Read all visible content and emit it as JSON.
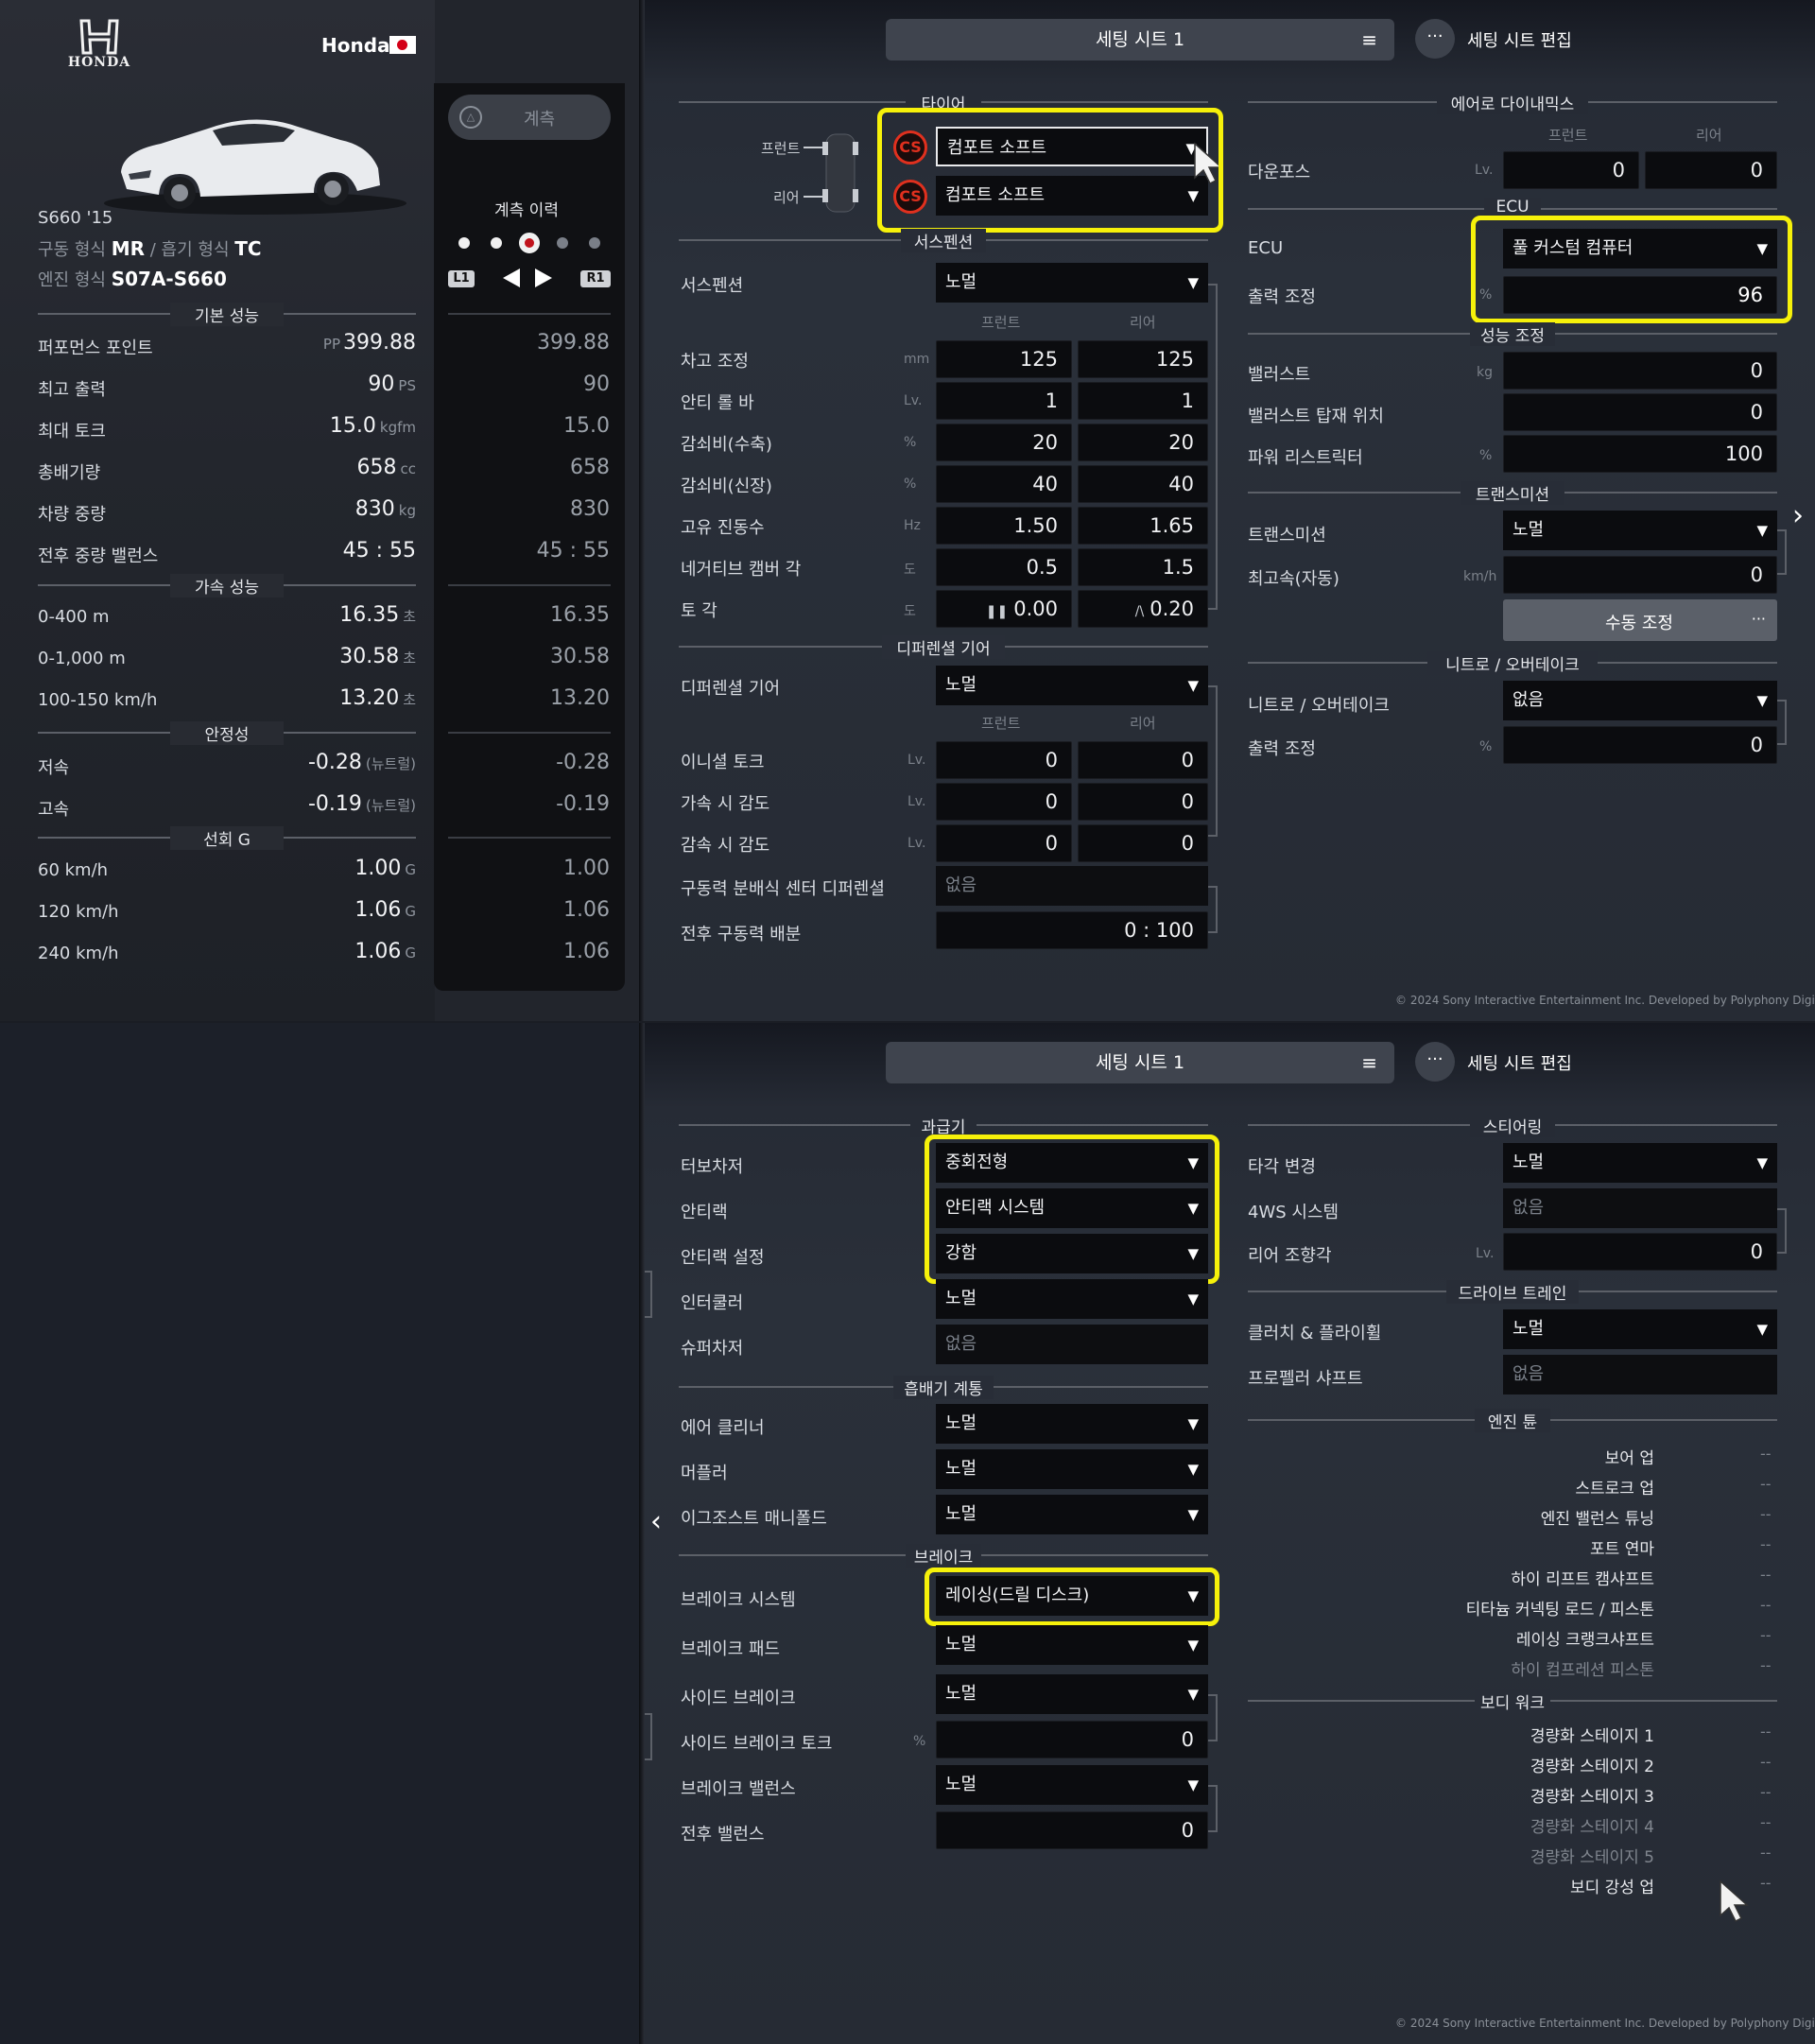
{
  "top_left": {
    "brand_logo_text": "HONDA",
    "maker": "Honda",
    "car_model": "S660 '15",
    "drivetrain_label": "구동 형식",
    "drivetrain": "MR",
    "aspiration_label": "흡기 형식",
    "aspiration": "TC",
    "engine_label": "엔진 형식",
    "engine": "S07A-S660"
  },
  "measure": {
    "button_label": "계측",
    "history_label": "계측 이력",
    "l1": "L1",
    "r1": "R1"
  },
  "basic": {
    "title": "기본 성능",
    "rows": [
      {
        "label": "퍼포먼스 포인트",
        "prefix": "PP",
        "value": "399.88",
        "unit": "",
        "cmp": "399.88"
      },
      {
        "label": "최고 출력",
        "prefix": "",
        "value": "90",
        "unit": "PS",
        "cmp": "90"
      },
      {
        "label": "최대 토크",
        "prefix": "",
        "value": "15.0",
        "unit": "kgfm",
        "cmp": "15.0"
      },
      {
        "label": "총배기량",
        "prefix": "",
        "value": "658",
        "unit": "cc",
        "cmp": "658"
      },
      {
        "label": "차량 중량",
        "prefix": "",
        "value": "830",
        "unit": "kg",
        "cmp": "830"
      },
      {
        "label": "전후 중량 밸런스",
        "prefix": "",
        "value": "45 : 55",
        "unit": "",
        "cmp": "45 : 55"
      }
    ]
  },
  "accel": {
    "title": "가속 성능",
    "rows": [
      {
        "label": "0-400 m",
        "value": "16.35",
        "unit": "초",
        "cmp": "16.35"
      },
      {
        "label": "0-1,000 m",
        "value": "30.58",
        "unit": "초",
        "cmp": "30.58"
      },
      {
        "label": "100-150 km/h",
        "value": "13.20",
        "unit": "초",
        "cmp": "13.20"
      }
    ]
  },
  "stability": {
    "title": "안정성",
    "rows": [
      {
        "label": "저속",
        "value": "-0.28",
        "unit": "(뉴트럴)",
        "cmp": "-0.28"
      },
      {
        "label": "고속",
        "value": "-0.19",
        "unit": "(뉴트럴)",
        "cmp": "-0.19"
      }
    ]
  },
  "turning": {
    "title": "선회 G",
    "rows": [
      {
        "label": "60 km/h",
        "value": "1.00",
        "unit": "G",
        "cmp": "1.00"
      },
      {
        "label": "120 km/h",
        "value": "1.06",
        "unit": "G",
        "cmp": "1.06"
      },
      {
        "label": "240 km/h",
        "value": "1.06",
        "unit": "G",
        "cmp": "1.06"
      }
    ]
  },
  "header": {
    "sheet": "세팅 시트 1",
    "more": "···",
    "edit": "세팅 시트 편집",
    "copyright": "© 2024 Sony Interactive Entertainment Inc. Developed by Polyphony Digital Inc."
  },
  "tire": {
    "title": "타이어",
    "front_label": "프런트",
    "rear_label": "리어",
    "badge": "CS",
    "front": "컴포트 소프트",
    "rear": "컴포트 소프트"
  },
  "suspension": {
    "title": "서스펜션",
    "label": "서스펜션",
    "value": "노멀",
    "col_front": "프런트",
    "col_rear": "리어",
    "rows": [
      {
        "label": "차고 조정",
        "unit": "mm",
        "front": "125",
        "rear": "125"
      },
      {
        "label": "안티 롤 바",
        "unit": "Lv.",
        "front": "1",
        "rear": "1"
      },
      {
        "label": "감쇠비(수축)",
        "unit": "%",
        "front": "20",
        "rear": "20"
      },
      {
        "label": "감쇠비(신장)",
        "unit": "%",
        "front": "40",
        "rear": "40"
      },
      {
        "label": "고유 진동수",
        "unit": "Hz",
        "front": "1.50",
        "rear": "1.65"
      },
      {
        "label": "네거티브 캠버 각",
        "unit": "도",
        "front": "0.5",
        "rear": "1.5"
      },
      {
        "label": "토 각",
        "unit": "도",
        "front": "0.00",
        "rear": "0.20"
      }
    ],
    "toe_front_icon": "❚❚",
    "toe_rear_icon": "/\\"
  },
  "diff": {
    "title": "디퍼렌셜 기어",
    "label": "디퍼렌셜 기어",
    "value": "노멀",
    "col_front": "프런트",
    "col_rear": "리어",
    "rows": [
      {
        "label": "이니셜 토크",
        "unit": "Lv.",
        "front": "0",
        "rear": "0"
      },
      {
        "label": "가속 시 감도",
        "unit": "Lv.",
        "front": "0",
        "rear": "0"
      },
      {
        "label": "감속 시 감도",
        "unit": "Lv.",
        "front": "0",
        "rear": "0"
      }
    ],
    "center_label": "구동력 분배식 센터 디퍼렌셜",
    "center_value": "없음",
    "split_label": "전후 구동력 배분",
    "split_value": "0 : 100"
  },
  "aero": {
    "title": "에어로 다이내믹스",
    "col_front": "프런트",
    "col_rear": "리어",
    "label": "다운포스",
    "unit": "Lv.",
    "front": "0",
    "rear": "0"
  },
  "ecu": {
    "title": "ECU",
    "label": "ECU",
    "value": "풀 커스텀 컴퓨터",
    "output_label": "출력 조정",
    "output_unit": "%",
    "output": "96"
  },
  "perf": {
    "title": "성능 조정",
    "ballast_label": "밸러스트",
    "ballast_unit": "kg",
    "ballast": "0",
    "ballast_pos_label": "밸러스트 탑재 위치",
    "ballast_pos": "0",
    "restrictor_label": "파워 리스트릭터",
    "restrictor_unit": "%",
    "restrictor": "100"
  },
  "trans": {
    "title": "트랜스미션",
    "label": "트랜스미션",
    "value": "노멀",
    "top_label": "최고속(자동)",
    "top_unit": "km/h",
    "top": "0",
    "manual": "수동 조정",
    "manual_more": "···"
  },
  "nitro": {
    "title": "니트로 / 오버테이크",
    "label": "니트로 / 오버테이크",
    "value": "없음",
    "output_label": "출력 조정",
    "output_unit": "%",
    "output": "0"
  },
  "forced": {
    "title": "과급기",
    "turbo_label": "터보차저",
    "turbo": "중회전형",
    "antilag_label": "안티랙",
    "antilag": "안티랙 시스템",
    "antilag_set_label": "안티랙 설정",
    "antilag_set": "강함",
    "intercooler_label": "인터쿨러",
    "intercooler": "노멀",
    "super_label": "슈퍼차저",
    "super": "없음"
  },
  "intake": {
    "title": "흡배기 계통",
    "air_label": "에어 클리너",
    "air": "노멀",
    "muffler_label": "머플러",
    "muffler": "노멀",
    "exhaust_label": "이그조스트 매니폴드",
    "exhaust": "노멀"
  },
  "brake": {
    "title": "브레이크",
    "system_label": "브레이크 시스템",
    "system": "레이싱(드릴 디스크)",
    "pad_label": "브레이크 패드",
    "pad": "노멀",
    "side_label": "사이드 브레이크",
    "side": "노멀",
    "side_torque_label": "사이드 브레이크 토크",
    "side_torque_unit": "%",
    "side_torque": "0",
    "balance_label": "브레이크 밸런스",
    "balance": "노멀",
    "fr_label": "전후 밸런스",
    "fr": "0"
  },
  "steering": {
    "title": "스티어링",
    "angle_label": "타각 변경",
    "angle": "노멀",
    "fourws_label": "4WS 시스템",
    "fourws": "없음",
    "rear_label": "리어 조향각",
    "rear_unit": "Lv.",
    "rear": "0"
  },
  "drivetrain": {
    "title": "드라이브 트레인",
    "clutch_label": "클러치 & 플라이휠",
    "clutch": "노멀",
    "prop_label": "프로펠러 샤프트",
    "prop": "없음"
  },
  "engine_tune": {
    "title": "엔진 튠",
    "items": [
      {
        "label": "보어 업",
        "value": "--"
      },
      {
        "label": "스트로크 업",
        "value": "--"
      },
      {
        "label": "엔진 밸런스 튜닝",
        "value": "--"
      },
      {
        "label": "포트 연마",
        "value": "--"
      },
      {
        "label": "하이 리프트 캠샤프트",
        "value": "--"
      },
      {
        "label": "티타늄 커넥팅 로드 / 피스톤",
        "value": "--"
      },
      {
        "label": "레이싱 크랭크샤프트",
        "value": "--"
      },
      {
        "label": "하이 컴프레션 피스톤",
        "value": "--"
      }
    ]
  },
  "body": {
    "title": "보디 워크",
    "items": [
      {
        "label": "경량화 스테이지 1",
        "value": "--"
      },
      {
        "label": "경량화 스테이지 2",
        "value": "--"
      },
      {
        "label": "경량화 스테이지 3",
        "value": "--"
      },
      {
        "label": "경량화 스테이지 4",
        "value": "--"
      },
      {
        "label": "경량화 스테이지 5",
        "value": "--"
      },
      {
        "label": "보디 강성 업",
        "value": "--"
      }
    ]
  }
}
